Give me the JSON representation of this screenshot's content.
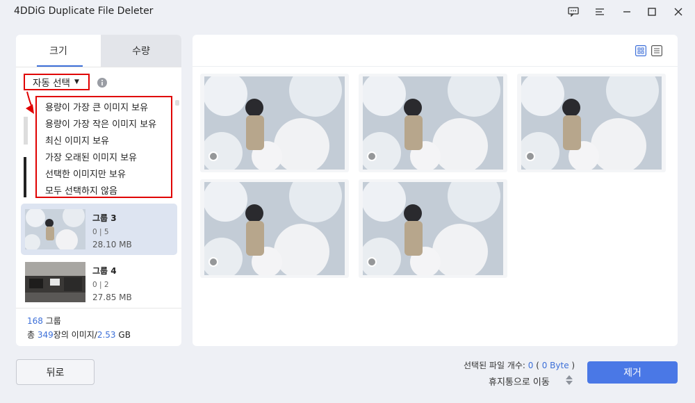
{
  "app": {
    "title": "4DDiG Duplicate File Deleter"
  },
  "window_controls": [
    "feedback-icon",
    "menu-icon",
    "minimize-icon",
    "maximize-icon",
    "close-icon"
  ],
  "tabs": [
    {
      "label": "크기",
      "active": true
    },
    {
      "label": "수량",
      "active": false
    }
  ],
  "auto_select": {
    "label": "자동 선택",
    "options": [
      "용량이 가장 큰 이미지 보유",
      "용량이 가장 작은 이미지 보유",
      "최신 이미지 보유",
      "가장 오래된 이미지 보유",
      "선택한 이미지만 보유",
      "모두 선택하지 않음"
    ]
  },
  "groups": [
    {
      "name": "그룹 3",
      "count": "0 | 5",
      "size": "28.10 MB",
      "selected": true
    },
    {
      "name": "그룹 4",
      "count": "0 | 2",
      "size": "27.85 MB",
      "selected": false
    }
  ],
  "summary": {
    "group_count": "168",
    "group_label": "그룹",
    "total_prefix": "총",
    "image_count": "349",
    "image_label": "장의 이미지/",
    "total_size": "2.53",
    "size_unit": "GB"
  },
  "footer": {
    "back_label": "뒤로",
    "selected_label": "선택된 파일 개수:",
    "selected_count": "0",
    "selected_size": "0 Byte",
    "trash_label": "휴지통으로 이동",
    "remove_label": "제거"
  },
  "colors": {
    "accent": "#3c6fd8",
    "button_blue": "#4a78e6",
    "highlight_red": "#e00000"
  }
}
